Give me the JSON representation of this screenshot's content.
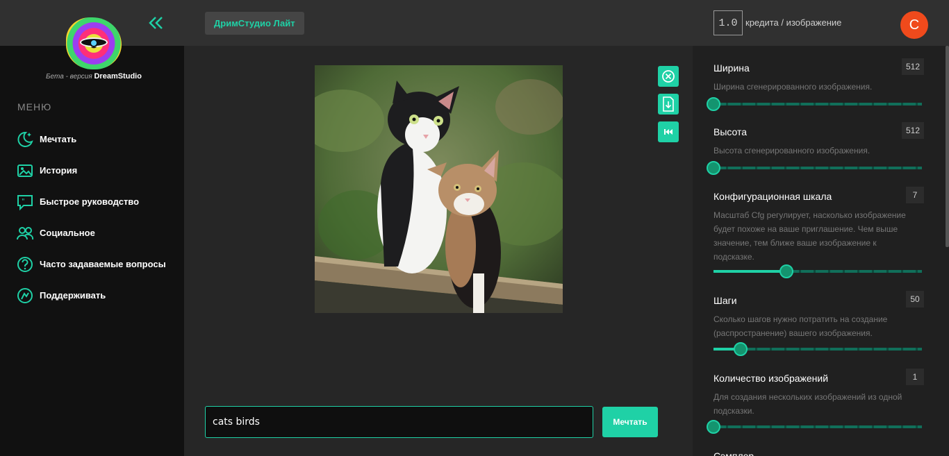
{
  "sidebar": {
    "logo_caption_prefix": "Бета - версия",
    "logo_caption_brand": "DreamStudio",
    "menu_title": "МЕНЮ",
    "items": [
      {
        "label": "Мечтать",
        "icon": "moon-sparkle-icon"
      },
      {
        "label": "История",
        "icon": "gallery-icon"
      },
      {
        "label": "Быстрое руководство",
        "icon": "quote-bubble-icon"
      },
      {
        "label": "Социальное",
        "icon": "users-icon"
      },
      {
        "label": "Часто задаваемые вопросы",
        "icon": "question-icon"
      },
      {
        "label": "Поддерживать",
        "icon": "support-icon"
      }
    ]
  },
  "header": {
    "app_name": "ДримСтудио Лайт",
    "credits_value": "1.0",
    "credits_label": "кредита / изображение",
    "avatar_letter": "C",
    "avatar_color": "#f04a1c"
  },
  "main": {
    "image_alt": "generated image of two cats",
    "prompt_value": "cats birds",
    "dream_button": "Мечтать",
    "actions": [
      "close-circle-icon",
      "download-icon",
      "rewind-icon"
    ]
  },
  "settings": [
    {
      "title": "Ширина",
      "value": "512",
      "desc": "Ширина сгенерированного изображения.",
      "level": 0.0
    },
    {
      "title": "Высота",
      "value": "512",
      "desc": "Высота сгенерированного изображения.",
      "level": 0.0
    },
    {
      "title": "Конфигурационная шкала",
      "value": "7",
      "desc": "Масштаб Cfg регулирует, насколько изображение будет похоже на ваше приглашение. Чем выше значение, тем ближе ваше изображение к подсказке.",
      "level": 0.35
    },
    {
      "title": "Шаги",
      "value": "50",
      "desc": "Сколько шагов нужно потратить на создание (распространение) вашего изображения.",
      "level": 0.13
    },
    {
      "title": "Количество изображений",
      "value": "1",
      "desc": "Для создания нескольких изображений из одной подсказки.",
      "level": 0.0
    },
    {
      "title": "Сэмплер"
    }
  ],
  "colors": {
    "accent": "#1fd1a6",
    "sidebar_bg": "#111111",
    "panel_bg": "#202020"
  }
}
